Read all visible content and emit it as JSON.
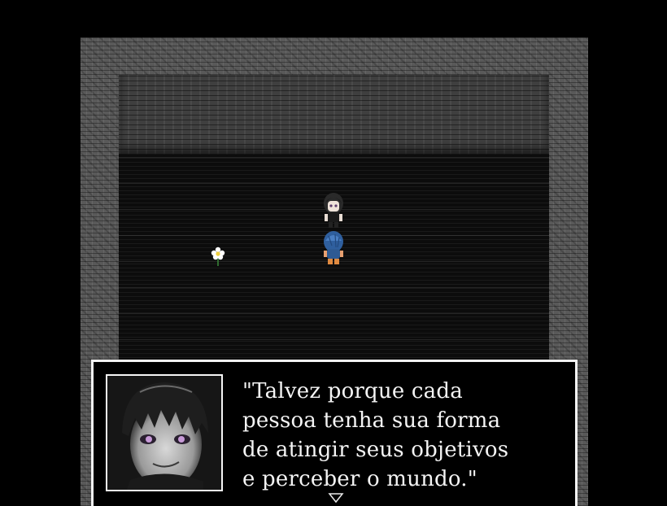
{
  "scene": {
    "type": "rpg-dialogue",
    "colors": {
      "wall": "#595959",
      "back_wall": "#3f3f3f",
      "floor": "#0c0c0c",
      "window_border": "#f2f2f2",
      "text": "#f4f4f4"
    }
  },
  "dialogue": {
    "text": "\"Talvez porque cada\npessoa tenha sua forma\nde atingir seus objetivos\ne perceber o mundo.\"",
    "portrait_icon": "character-portrait-icon",
    "continue_icon": "triangle-down-icon"
  }
}
